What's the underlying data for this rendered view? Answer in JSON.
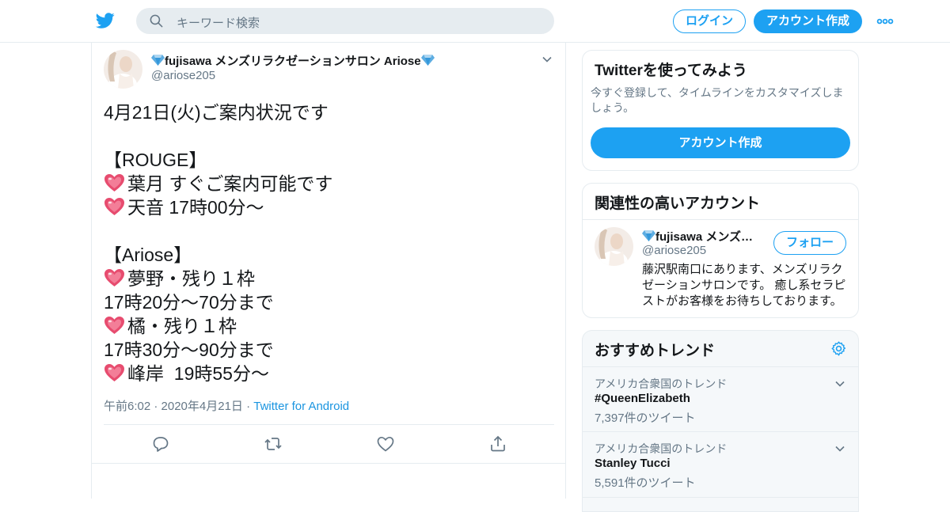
{
  "header": {
    "search_placeholder": "キーワード検索",
    "login_label": "ログイン",
    "signup_label": "アカウント作成"
  },
  "tweet": {
    "display_name": "fujisawa メンズリラクゼーションサロン Ariose",
    "handle": "@ariose205",
    "lines": [
      {
        "heart": false,
        "text": "4月21日(火)ご案内状況です"
      },
      {
        "heart": false,
        "text": ""
      },
      {
        "heart": false,
        "text": "【ROUGE】"
      },
      {
        "heart": true,
        "text": "葉月 すぐご案内可能です"
      },
      {
        "heart": true,
        "text": "天音 17時00分～"
      },
      {
        "heart": false,
        "text": ""
      },
      {
        "heart": false,
        "text": "【Ariose】"
      },
      {
        "heart": true,
        "text": "夢野・残り１枠"
      },
      {
        "heart": false,
        "text": "17時20分～70分まで"
      },
      {
        "heart": true,
        "text": "橘・残り１枠"
      },
      {
        "heart": false,
        "text": "17時30分～90分まで"
      },
      {
        "heart": true,
        "text": "峰岸  19時55分〜"
      }
    ],
    "timestamp": "午前6:02 · 2020年4月21日 · ",
    "source": "Twitter for Android"
  },
  "signup_card": {
    "title": "Twitterを使ってみよう",
    "description": "今すぐ登録して、タイムラインをカスタマイズしましょう。",
    "button_label": "アカウント作成"
  },
  "related_card": {
    "title": "関連性の高いアカウント",
    "account_name": "fujisawa メンズ…",
    "account_handle": "@ariose205",
    "follow_label": "フォロー",
    "bio": "藤沢駅南口にあります、メンズリラクゼーションサロンです。 癒し系セラピストがお客様をお待ちしております。"
  },
  "trends_card": {
    "title": "おすすめトレンド",
    "items": [
      {
        "context": "アメリカ合衆国のトレンド",
        "name": "#QueenElizabeth",
        "count": "7,397件のツイート"
      },
      {
        "context": "アメリカ合衆国のトレンド",
        "name": "Stanley Tucci",
        "count": "5,591件のツイート"
      }
    ]
  },
  "colors": {
    "accent": "#1da1f2",
    "link": "#1b95e0",
    "secondary_text": "#657786",
    "border": "#e6ecf0"
  },
  "icons": [
    "twitter-bird-icon",
    "search-icon",
    "more-icon",
    "gem-icon",
    "chevron-down-icon",
    "heart-emoji-icon",
    "reply-icon",
    "retweet-icon",
    "like-icon",
    "share-icon",
    "gear-icon"
  ]
}
